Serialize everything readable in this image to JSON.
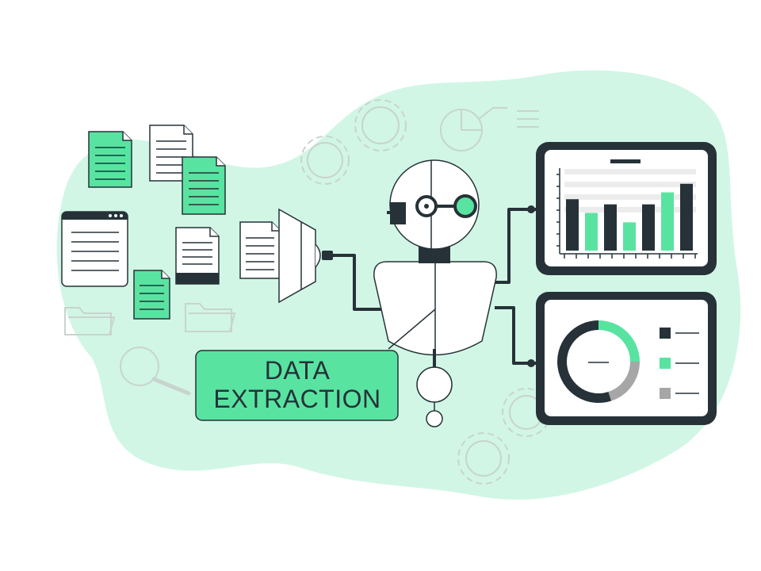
{
  "label": {
    "line1": "DATA",
    "line2": "EXTRACTION"
  },
  "colors": {
    "blob": "#d1f6e5",
    "accent": "#59e3a1",
    "label_fill": "#59e3a1",
    "dark": "#263238",
    "outline": "#263238",
    "muted": "#a6a6a6",
    "faint": "#c8d4cf",
    "white": "#ffffff",
    "bar_grid": "#ececec"
  },
  "icons": [
    "document-icon",
    "browser-window-icon",
    "folder-icon",
    "magnifier-icon",
    "gear-icon",
    "pie-chart-icon",
    "funnel-icon",
    "robot-icon",
    "bar-chart-monitor-icon",
    "donut-chart-monitor-icon"
  ],
  "bar_chart": {
    "bars": [
      {
        "value": 0.6,
        "color": "dark"
      },
      {
        "value": 0.44,
        "color": "accent"
      },
      {
        "value": 0.54,
        "color": "dark"
      },
      {
        "value": 0.33,
        "color": "accent"
      },
      {
        "value": 0.54,
        "color": "dark"
      },
      {
        "value": 0.68,
        "color": "accent"
      },
      {
        "value": 0.78,
        "color": "dark"
      }
    ]
  },
  "donut_chart": {
    "slices": [
      {
        "fraction": 0.25,
        "color": "accent"
      },
      {
        "fraction": 0.2,
        "color": "muted"
      },
      {
        "fraction": 0.55,
        "color": "dark"
      }
    ],
    "legend": [
      {
        "color": "dark"
      },
      {
        "color": "accent"
      },
      {
        "color": "muted"
      }
    ]
  }
}
